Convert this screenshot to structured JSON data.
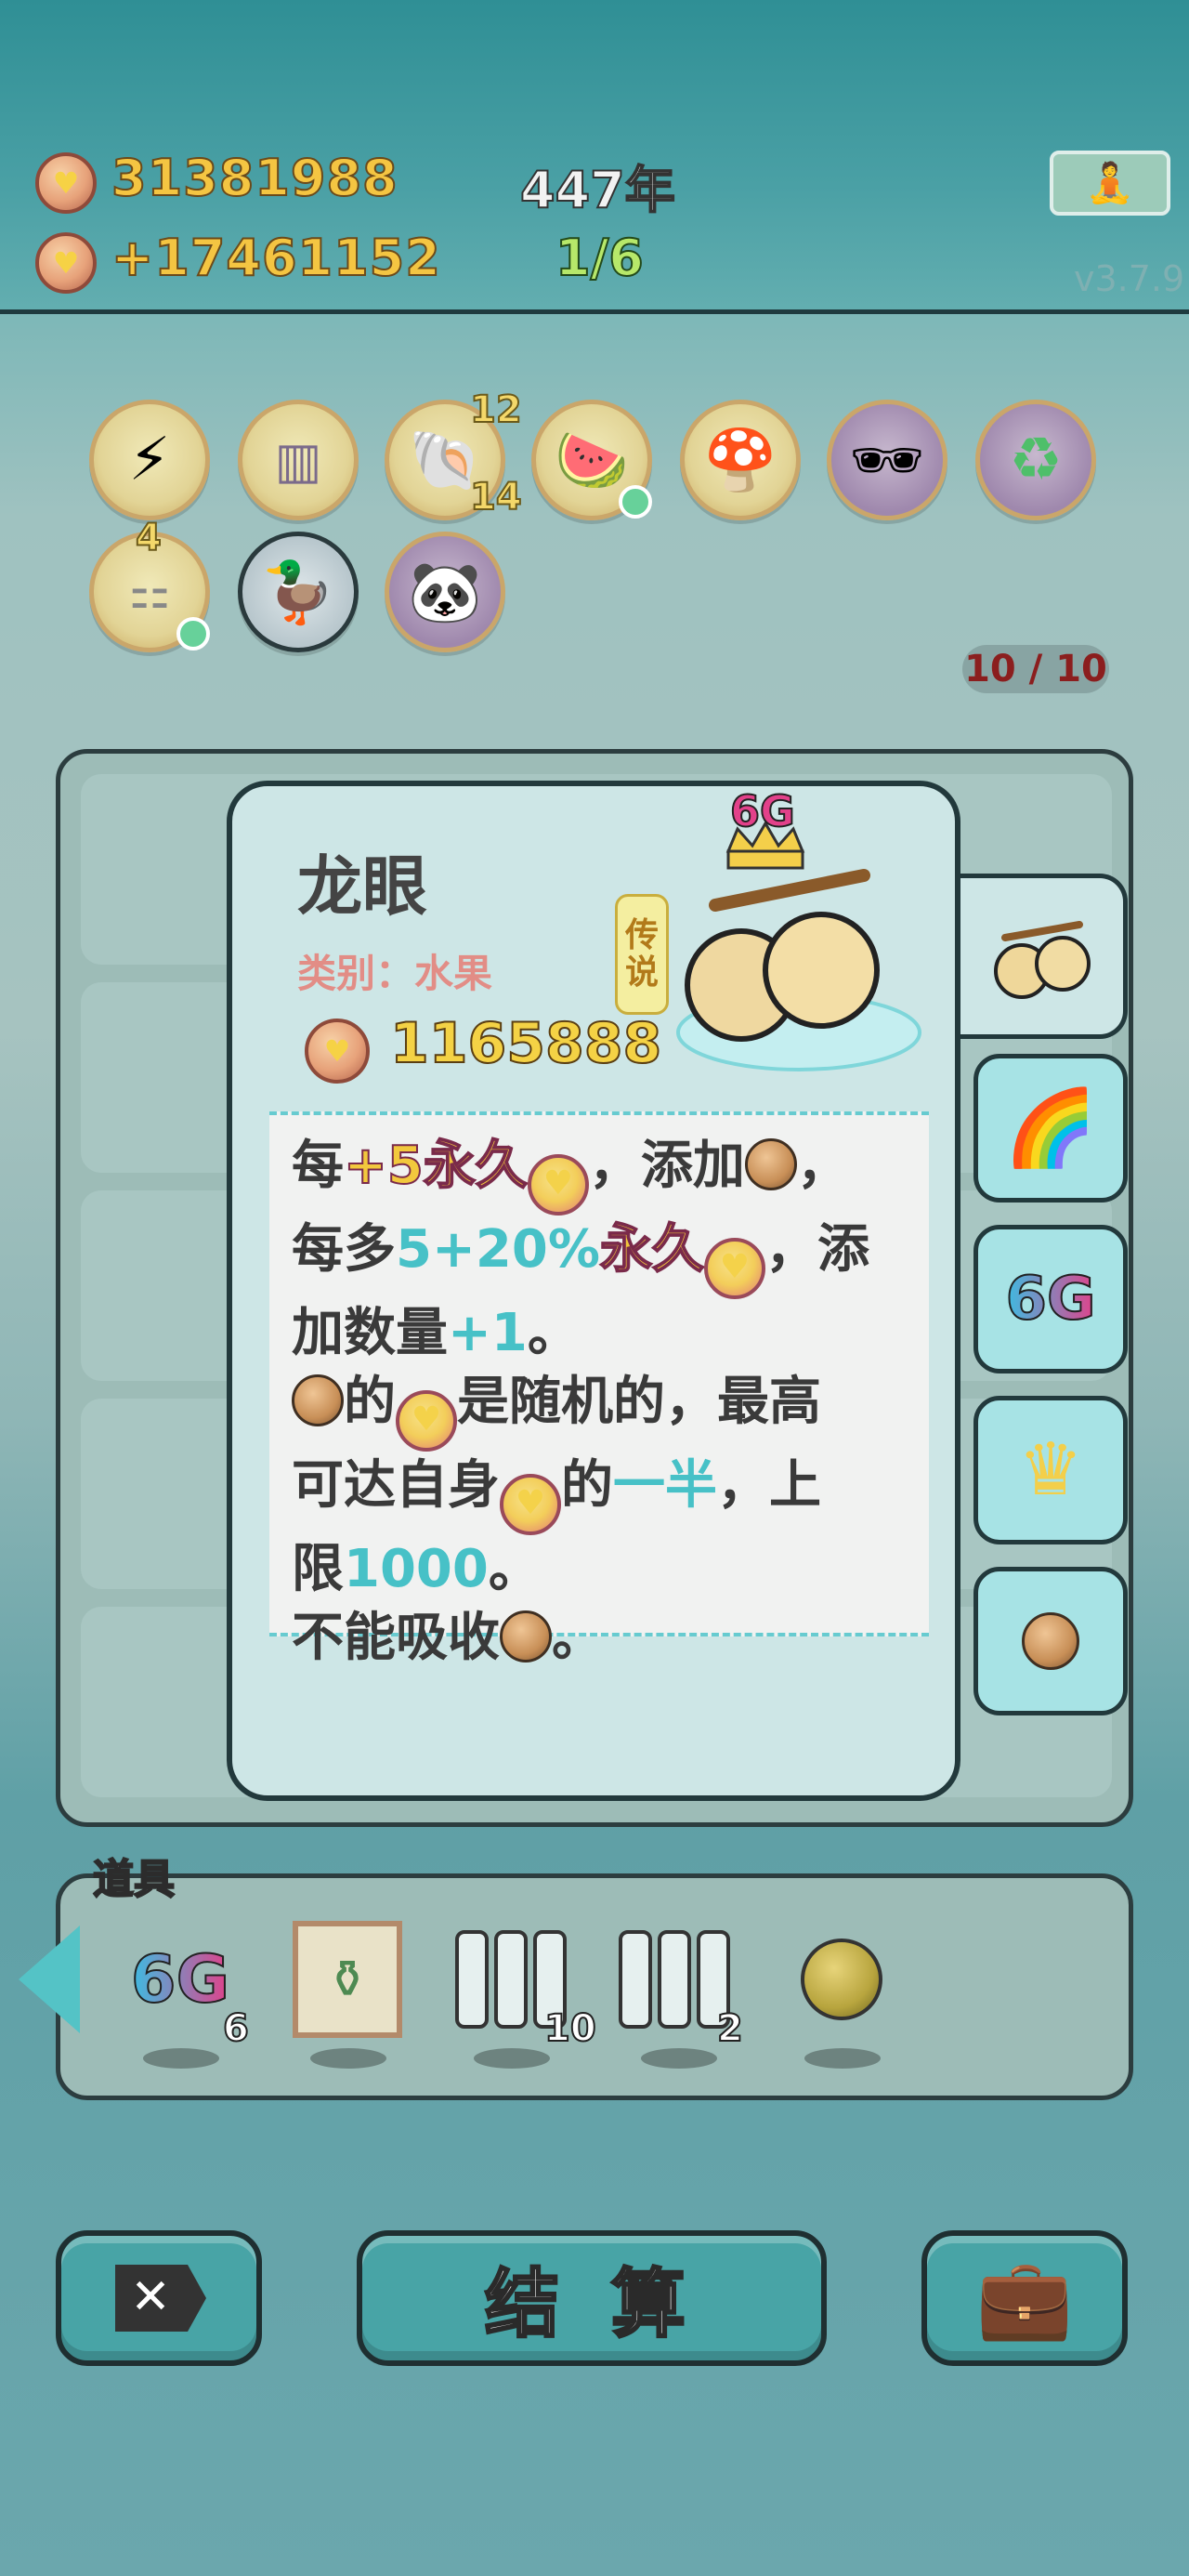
{
  "hud": {
    "coins": "31381988",
    "income": "+17461152",
    "years": "447年",
    "spins": "1/6",
    "version": "v3.7.9"
  },
  "relics": [
    {
      "name": "lightning-icon",
      "badge_top": "",
      "badge_bottom": ""
    },
    {
      "name": "skirt-icon",
      "badge_top": "",
      "badge_bottom": ""
    },
    {
      "name": "shell-icon",
      "badge_top": "12",
      "badge_bottom": "14"
    },
    {
      "name": "fruit-basket-icon",
      "badge_top": "",
      "badge_bottom": ""
    },
    {
      "name": "mushroom-icon",
      "badge_top": "",
      "badge_bottom": ""
    },
    {
      "name": "longan-mask-icon",
      "badge_top": "",
      "badge_bottom": ""
    },
    {
      "name": "recycle-icon",
      "badge_top": "",
      "badge_bottom": ""
    },
    {
      "name": "egg-tray-icon",
      "badge_top": "4",
      "badge_bottom": ""
    },
    {
      "name": "pot-duck-icon",
      "badge_top": "",
      "badge_bottom": ""
    },
    {
      "name": "panda-icon",
      "badge_top": "",
      "badge_bottom": ""
    }
  ],
  "board": {
    "counter": "10 / 10"
  },
  "card": {
    "title": "龙眼",
    "category": "类别：水果",
    "price": "1165888",
    "rarity": [
      "传",
      "说"
    ],
    "crown_label": "6G",
    "desc": {
      "l1_a": "每",
      "l1_b": "+5永久",
      "l1_c": "，添加",
      "l1_d": "，",
      "l2_a": "每多",
      "l2_b": "5+20%",
      "l2_c": "永久",
      "l2_d": "，添",
      "l3_a": "加数量",
      "l3_b": "+1",
      "l3_c": "。",
      "l4_a": "的",
      "l4_b": "是随机的，最高",
      "l5_a": "可达自身",
      "l5_b": "的",
      "l5_c": "一半",
      "l5_d": "，上",
      "l6_a": "限",
      "l6_b": "1000",
      "l6_c": "。",
      "l7_a": "不能吸收",
      "l7_b": "。"
    }
  },
  "side_tabs": [
    "longan",
    "rainbow",
    "6G",
    "crown",
    "nut"
  ],
  "props": {
    "title": "道具",
    "items": [
      {
        "label": "6G",
        "count": "6"
      },
      {
        "label": "vase",
        "count": ""
      },
      {
        "label": "tubes-3",
        "count": "10"
      },
      {
        "label": "tubes-empty",
        "count": "2"
      },
      {
        "label": "orb",
        "count": ""
      }
    ]
  },
  "buttons": {
    "settle": "结 算"
  },
  "colors": {
    "accent": "#48a4a6",
    "gold": "#f4c542",
    "teal": "#47c1c7"
  }
}
